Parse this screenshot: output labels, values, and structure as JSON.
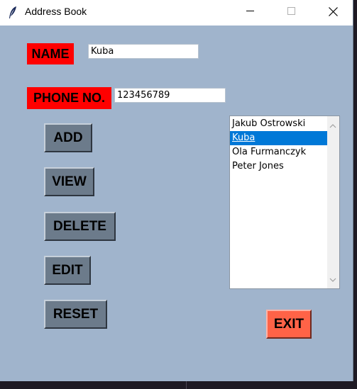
{
  "window": {
    "title": "Address Book",
    "icons": {
      "app": "feather-icon",
      "minimize": "minimize-icon",
      "maximize": "maximize-icon",
      "close": "close-icon"
    }
  },
  "form": {
    "name_label": "NAME",
    "name_value": "Kuba",
    "phone_label": "PHONE NO.",
    "phone_value": "123456789"
  },
  "buttons": {
    "add": "ADD",
    "view": "VIEW",
    "delete": "DELETE",
    "edit": "EDIT",
    "reset": "RESET",
    "exit": "EXIT"
  },
  "contacts": {
    "items": [
      "Jakub Ostrowski",
      "Kuba",
      "Ola Furmanczyk",
      "Peter Jones"
    ],
    "selected": "Kuba"
  },
  "colors": {
    "background": "#a0b4cc",
    "label": "#ff0000",
    "button": "#6c7b8b",
    "exit_button": "#ff6347",
    "selection": "#0078d7"
  }
}
